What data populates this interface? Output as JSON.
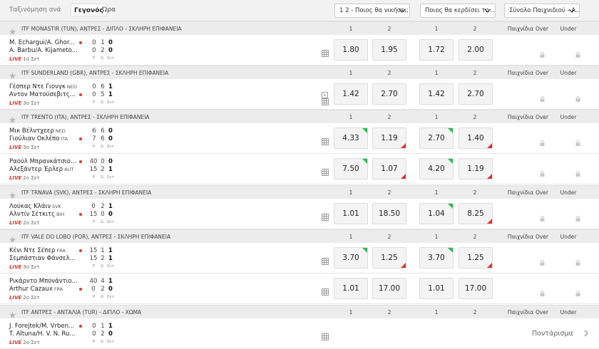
{
  "topbar": {
    "sort_label": "Ταξινόμηση ανά",
    "tabs": [
      "Γεγονός",
      "Ώρα"
    ],
    "dropdowns": [
      "1 2 - Ποιος θα νικήσει;",
      "Ποιος θα κερδίσει το ...",
      "Σύνολο Παιχνιδιού - Α..."
    ]
  },
  "columns": {
    "c1": "1",
    "c2": "2",
    "c3": "1",
    "c4": "2",
    "games": "Παιχνίδια",
    "over": "Over",
    "under": "Under"
  },
  "leagues": [
    {
      "name": "ITF MONASTIR (TUN), ΑΝΤΡΕΣ - ΔΙΠΛΟ - ΣΚΛΗΡΗ ΕΠΙΦΑΝΕΙΑ"
    },
    {
      "name": "ITF SUNDERLAND (GBR), ΑΝΤΡΕΣ - ΣΚΛΗΡΗ ΕΠΙΦΑΝΕΙΑ"
    },
    {
      "name": "ITF TRENTO (ITA), ΑΝΤΡΕΣ - ΣΚΛΗΡΗ ΕΠΙΦΑΝΕΙΑ"
    },
    {
      "name": "ITF TRNAVA (SVK), ΑΝΤΡΕΣ - ΣΚΛΗΡΗ ΕΠΙΦΑΝΕΙΑ"
    },
    {
      "name": "ITF VALE DO LOBO (POR), ΑΝΤΡΕΣ - ΣΚΛΗΡΗ ΕΠΙΦΑΝΕΙΑ"
    },
    {
      "name": "ITF ΑΝΤΡΕΣ - ΑΝΤΑΛΙΑ (TUR) - ΔΙΠΛΟ - ΧΩΜΑ"
    }
  ],
  "score_labels": {
    "p": "P",
    "g": "G",
    "set": "Σετ"
  },
  "live_label": "LIVE",
  "matches": [
    {
      "p1": "M. Echargui/A. Ghor...",
      "c1": "",
      "p2": "A. Barbu/A. Kijameto...",
      "c2": "",
      "s1": [
        "0",
        "1",
        "0"
      ],
      "s2": [
        "0",
        "2",
        "0"
      ],
      "set": "1ο Σετ",
      "odds": [
        "1.80",
        "1.95",
        "1.72",
        "2.00"
      ]
    },
    {
      "p1": "Γέσπερ Ντε Γιονγκ",
      "c1": "NED",
      "p2": "Αντον Ματούσεβιτς...",
      "c2": "",
      "s1": [
        "0",
        "6",
        "1"
      ],
      "s2": [
        "0",
        "5",
        "1"
      ],
      "set": "3ο Σετ",
      "odds": [
        "1.42",
        "2.70",
        "1.42",
        "2.70"
      ]
    },
    {
      "p1": "Μικ Βέλντχεερ",
      "c1": "NED",
      "p2": "Γιούλιαν Οκλέπο",
      "c2": "ITA",
      "s1": [
        "6",
        "6",
        "0"
      ],
      "s2": [
        "7",
        "6",
        "0"
      ],
      "set": "3ο Σετ",
      "odds": [
        "4.33",
        "1.19",
        "2.70",
        "1.40"
      ]
    },
    {
      "p1": "Ραούλ Μπρανκάτσιο...",
      "c1": "",
      "p2": "Αλεξάντερ Έρλερ",
      "c2": "AUT",
      "s1": [
        "40",
        "0",
        "0"
      ],
      "s2": [
        "15",
        "2",
        "1"
      ],
      "set": "2ο Σετ",
      "odds": [
        "7.50",
        "1.07",
        "4.20",
        "1.19"
      ]
    },
    {
      "p1": "Λούκας Κλάιν",
      "c1": "SVK",
      "p2": "Αλντίν Σέτκιτς",
      "c2": "BIH",
      "s1": [
        "0",
        "2",
        "1"
      ],
      "s2": [
        "15",
        "0",
        "0"
      ],
      "set": "2ο Σετ",
      "odds": [
        "1.01",
        "18.50",
        "1.04",
        "8.25"
      ]
    },
    {
      "p1": "Κένι Ντε Σέπερ",
      "c1": "FRA",
      "p2": "Σεμπάστιαν Φάνσελ...",
      "c2": "",
      "s1": [
        "15",
        "1",
        "1"
      ],
      "s2": [
        "15",
        "2",
        "1"
      ],
      "set": "3ο Σετ",
      "odds": [
        "3.70",
        "1.25",
        "3.70",
        "1.25"
      ]
    },
    {
      "p1": "Ρικάρντο Μπονάντιο...",
      "c1": "",
      "p2": "Arthur Cazaux",
      "c2": "FRA",
      "s1": [
        "40",
        "4",
        "1"
      ],
      "s2": [
        "0",
        "2",
        "0"
      ],
      "set": "2ο Σετ",
      "odds": [
        "1.01",
        "17.00",
        "1.01",
        "17.00"
      ]
    },
    {
      "p1": "J. Forejtek/M. Vrben...",
      "c1": "",
      "p2": "T. Altuna/H. V. N. Ru...",
      "c2": "",
      "s1": [
        "0",
        "1",
        "1"
      ],
      "s2": [
        "0",
        "2",
        "0"
      ],
      "set": "2ο Σετ",
      "odds": []
    }
  ],
  "more_label": "Ποντάρισμα",
  "colors": {
    "live": "#e03326",
    "odds_up": "#2dbb52",
    "odds_down": "#e5332a",
    "header_bg": "#ececec"
  }
}
